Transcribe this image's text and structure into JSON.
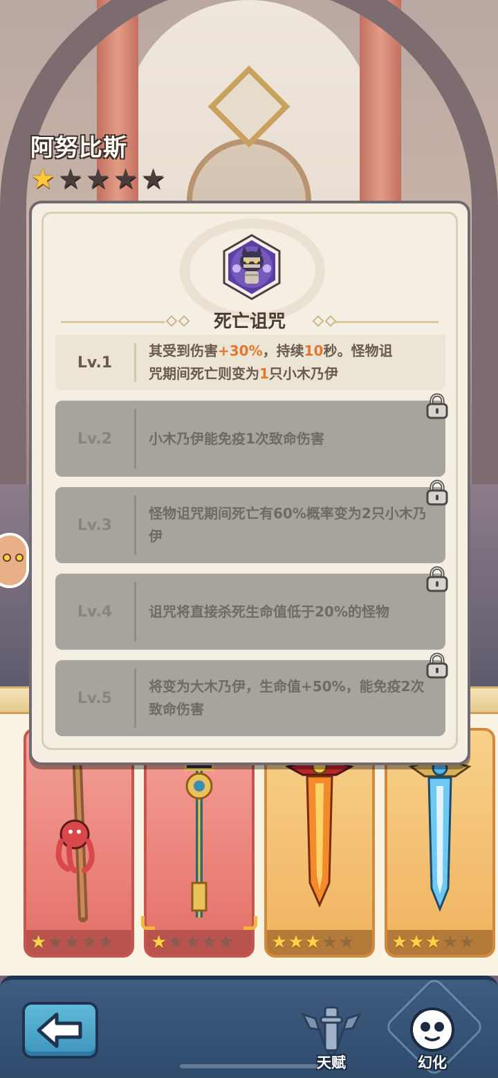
{
  "hero": {
    "name": "阿努比斯",
    "stars_total": 5,
    "stars_filled": 1
  },
  "skill": {
    "title": "死亡诅咒",
    "icon": "mummy-skill-icon",
    "levels": [
      {
        "label": "Lv.1",
        "locked": false,
        "line1_parts": [
          "其受到伤害",
          "+30%",
          "，持续",
          "10",
          "秒。怪物诅"
        ],
        "line2_parts": [
          "咒期间死亡则变为",
          "1",
          "只小木乃伊"
        ]
      },
      {
        "label": "Lv.2",
        "locked": true,
        "text": "小木乃伊能免疫1次致命伤害"
      },
      {
        "label": "Lv.3",
        "locked": true,
        "text": "怪物诅咒期间死亡有60%概率变为2只小木乃伊"
      },
      {
        "label": "Lv.4",
        "locked": true,
        "text": "诅咒将直接杀死生命值低于20%的怪物"
      },
      {
        "label": "Lv.5",
        "locked": true,
        "text": "将变为大木乃伊，生命值+50%，能免疫2次致命伤害"
      }
    ]
  },
  "weapons": [
    {
      "name": "octopus-staff",
      "rarity": "red",
      "stars": 1,
      "max_stars": 5,
      "selected": false
    },
    {
      "name": "anubis-staff",
      "rarity": "red",
      "stars": 1,
      "max_stars": 5,
      "selected": true
    },
    {
      "name": "flame-sword",
      "rarity": "gold",
      "stars": 3,
      "max_stars": 5,
      "selected": false
    },
    {
      "name": "ice-sword",
      "rarity": "gold",
      "stars": 3,
      "max_stars": 5,
      "selected": false
    }
  ],
  "nav": {
    "back_icon": "arrow-left-icon",
    "tabs": [
      {
        "label": "天赋",
        "icon": "talent-emblem-icon",
        "active": false
      },
      {
        "label": "幻化",
        "icon": "transform-icon",
        "active": true
      }
    ]
  },
  "colors": {
    "highlight": "#e2782c",
    "star_on": "#ffc83a",
    "bottom_bar": "#3f5c80"
  }
}
